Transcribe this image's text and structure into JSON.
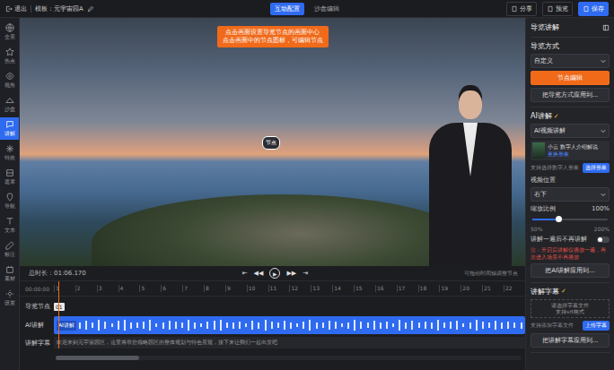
{
  "topbar": {
    "exit": "退出",
    "template": "模板：元宇宙园A",
    "tabs": [
      {
        "label": "互动配置",
        "selected": true
      },
      {
        "label": "沙盘编辑",
        "selected": false
      }
    ],
    "actions": [
      {
        "label": "分享",
        "primary": false
      },
      {
        "label": "预览",
        "primary": false
      },
      {
        "label": "保存",
        "primary": true
      }
    ]
  },
  "sidebar": [
    {
      "label": "全景",
      "selected": false
    },
    {
      "label": "热点",
      "selected": false
    },
    {
      "label": "视角",
      "selected": false
    },
    {
      "label": "沙盘",
      "selected": false
    },
    {
      "label": "讲解",
      "selected": true
    },
    {
      "label": "特效",
      "selected": false
    },
    {
      "label": "遮罩",
      "selected": false
    },
    {
      "label": "导航",
      "selected": false
    },
    {
      "label": "文本",
      "selected": false
    },
    {
      "label": "标注",
      "selected": false
    },
    {
      "label": "素材",
      "selected": false
    },
    {
      "label": "设置",
      "selected": false
    }
  ],
  "viewport": {
    "tip": [
      "点击画面设置导览节点的画面中心",
      "点击画面中的节点图标，可编辑节点"
    ],
    "node": "节点"
  },
  "timeline": {
    "total": "总时长：01:06.170",
    "controls": [
      "⇤",
      "◀◀",
      "▶",
      "▶▶",
      "⇥"
    ],
    "hint": "可拖动时间轴调整节点",
    "ruler": [
      "00:00:00",
      "1",
      "2",
      "3",
      "4",
      "5",
      "6",
      "7",
      "8",
      "9",
      "10",
      "11",
      "12",
      "13",
      "14",
      "15",
      "16",
      "17",
      "18",
      "19",
      "20",
      "21",
      "22"
    ],
    "playhead": 0.01,
    "tracks": [
      {
        "label": "导览节点",
        "kind": "nodes",
        "marker": "01"
      },
      {
        "label": "AI讲解",
        "kind": "audio",
        "clip": "AI讲解"
      },
      {
        "label": "讲解字幕",
        "kind": "subtitle",
        "text": "欢迎来到元宇宙园区，这里将带您领略园区的整体规划与特色景观，接下来让我们一起出发吧"
      }
    ],
    "waveform": [
      0.5,
      0.7,
      0.4,
      0.8,
      0.6,
      0.3,
      0.7,
      0.9,
      0.5,
      0.4,
      0.6,
      0.8,
      0.3,
      0.5,
      0.7,
      0.6,
      0.4,
      0.9,
      0.5,
      0.3,
      0.6,
      0.7,
      0.8,
      0.4,
      0.5,
      0.6,
      0.3,
      0.7,
      0.5,
      0.8,
      0.6,
      0.4,
      0.7,
      0.5,
      0.3,
      0.6,
      0.9,
      0.5,
      0.4,
      0.7,
      0.6,
      0.3,
      0.5,
      0.8,
      0.6,
      0.4,
      0.7,
      0.5,
      0.6,
      0.3,
      0.8,
      0.5,
      0.7,
      0.4,
      0.6,
      0.5,
      0.9,
      0.4,
      0.6,
      0.7,
      0.3,
      0.5,
      0.8,
      0.6,
      0.4,
      0.7,
      0.5,
      0.6,
      0.4,
      0.5
    ],
    "scrollbar": 0.18
  },
  "panel": {
    "title": "导览讲解",
    "guide": {
      "title": "导览方式",
      "mode": "自定义",
      "edit_button": "节点编辑",
      "apply_button": "把导览方式应用到..."
    },
    "ai": {
      "title": "AI讲解",
      "check": "✓",
      "enabled": true,
      "mode": "AI视频讲解",
      "avatar_name": "小云 数字人介绍解说",
      "avatar_link": "更换形象",
      "note": "支持选择数字人形象",
      "choose_button": "选择形象",
      "position_label": "视频位置",
      "position": "右下",
      "scale_label": "缩放比例",
      "scale": "100%",
      "scale_level": 0.35,
      "scale_min": "50%",
      "scale_max": "200%",
      "once_label": "讲解一遍后不再讲解",
      "once_on": false,
      "warning": "注：开启后讲解仅播放一遍，再次进入场景不再播放",
      "apply_button": "把AI讲解应用到..."
    },
    "subtitle": {
      "title": "讲解字幕",
      "check": "✓",
      "enabled": true,
      "upload_box": [
        "请选择字幕文件",
        "支持srt格式"
      ],
      "upload_note": "支持添加字幕文件",
      "upload_button": "上传字幕",
      "apply_button": "把讲解字幕应用到..."
    }
  }
}
